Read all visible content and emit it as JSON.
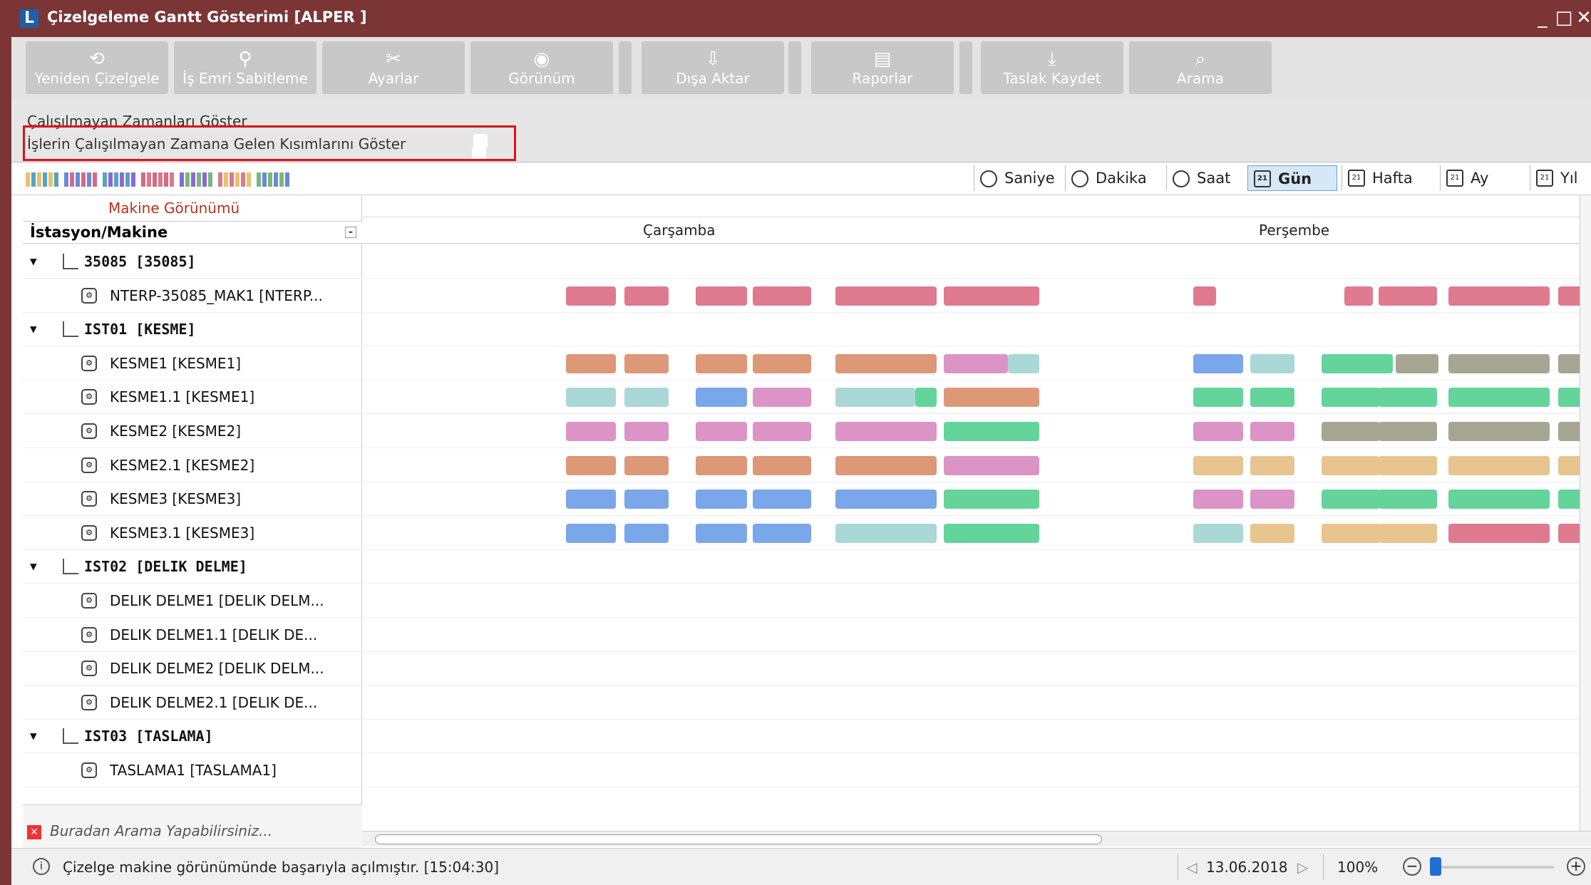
{
  "window": {
    "title": "Çizelgeleme Gantt Gösterimi [ALPER ]",
    "app_icon": "L"
  },
  "toolbar": [
    {
      "label": "Yeniden Çizelgele",
      "icon": "refresh-icon"
    },
    {
      "label": "İş Emri Sabitleme",
      "icon": "pin-icon"
    },
    {
      "label": "Ayarlar",
      "icon": "tools-icon"
    },
    {
      "label": "Görünüm",
      "icon": "view-icon"
    },
    {
      "label": "Dışa Aktar",
      "icon": "export-icon"
    },
    {
      "label": "Raporlar",
      "icon": "report-icon"
    },
    {
      "label": "Taslak Kaydet",
      "icon": "download-icon"
    },
    {
      "label": "Arama",
      "icon": "search-icon"
    }
  ],
  "options": {
    "show_nonworking": "Çalışılmayan Zamanları Göster",
    "show_job_nonworking": "İşlerin Çalışılmayan Zamana Gelen Kısımlarını Göster"
  },
  "scales": [
    "Saniye",
    "Dakika",
    "Saat",
    "Gün",
    "Hafta",
    "Ay",
    "Yıl"
  ],
  "active_scale": "Gün",
  "left": {
    "view_link": "Makine Görünümü",
    "column_header": "İstasyon/Makine",
    "rows": [
      {
        "type": "group",
        "label": "35085 [35085]"
      },
      {
        "type": "machine",
        "label": "NTERP-35085_MAK1 [NTERP..."
      },
      {
        "type": "group",
        "label": "IST01 [KESME]"
      },
      {
        "type": "machine",
        "label": "KESME1 [KESME1]"
      },
      {
        "type": "machine",
        "label": "KESME1.1 [KESME1]"
      },
      {
        "type": "machine",
        "label": "KESME2 [KESME2]"
      },
      {
        "type": "machine",
        "label": "KESME2.1 [KESME2]"
      },
      {
        "type": "machine",
        "label": "KESME3 [KESME3]"
      },
      {
        "type": "machine",
        "label": "KESME3.1 [KESME3]"
      },
      {
        "type": "group",
        "label": "IST02 [DELIK DELME]"
      },
      {
        "type": "machine",
        "label": "DELIK DELME1 [DELIK DELM..."
      },
      {
        "type": "machine",
        "label": "DELIK DELME1.1 [DELIK DE..."
      },
      {
        "type": "machine",
        "label": "DELIK DELME2 [DELIK DELM..."
      },
      {
        "type": "machine",
        "label": "DELIK DELME2.1 [DELIK DE..."
      },
      {
        "type": "group",
        "label": "IST03 [TASLAMA]"
      },
      {
        "type": "machine",
        "label": "TASLAMA1 [TASLAMA1]"
      }
    ],
    "search_placeholder": "Buradan Arama Yapabilirsiniz..."
  },
  "days": [
    "Çarşamba",
    "Perşembe"
  ],
  "status": {
    "message": "Çizelge makine görünümünde başarıyla açılmıştır. [15:04:30]",
    "date": "13.06.2018",
    "zoom": "100%"
  },
  "colors": {
    "title_bar": "#7b3535",
    "pink_red": "#e07a8e",
    "salmon": "#dd9878",
    "blue": "#7aa6ea",
    "magenta": "#dc94c6",
    "teal": "#a9d8d6",
    "green": "#64d49a",
    "tan": "#e8c48e",
    "grey": "#a9a593"
  }
}
